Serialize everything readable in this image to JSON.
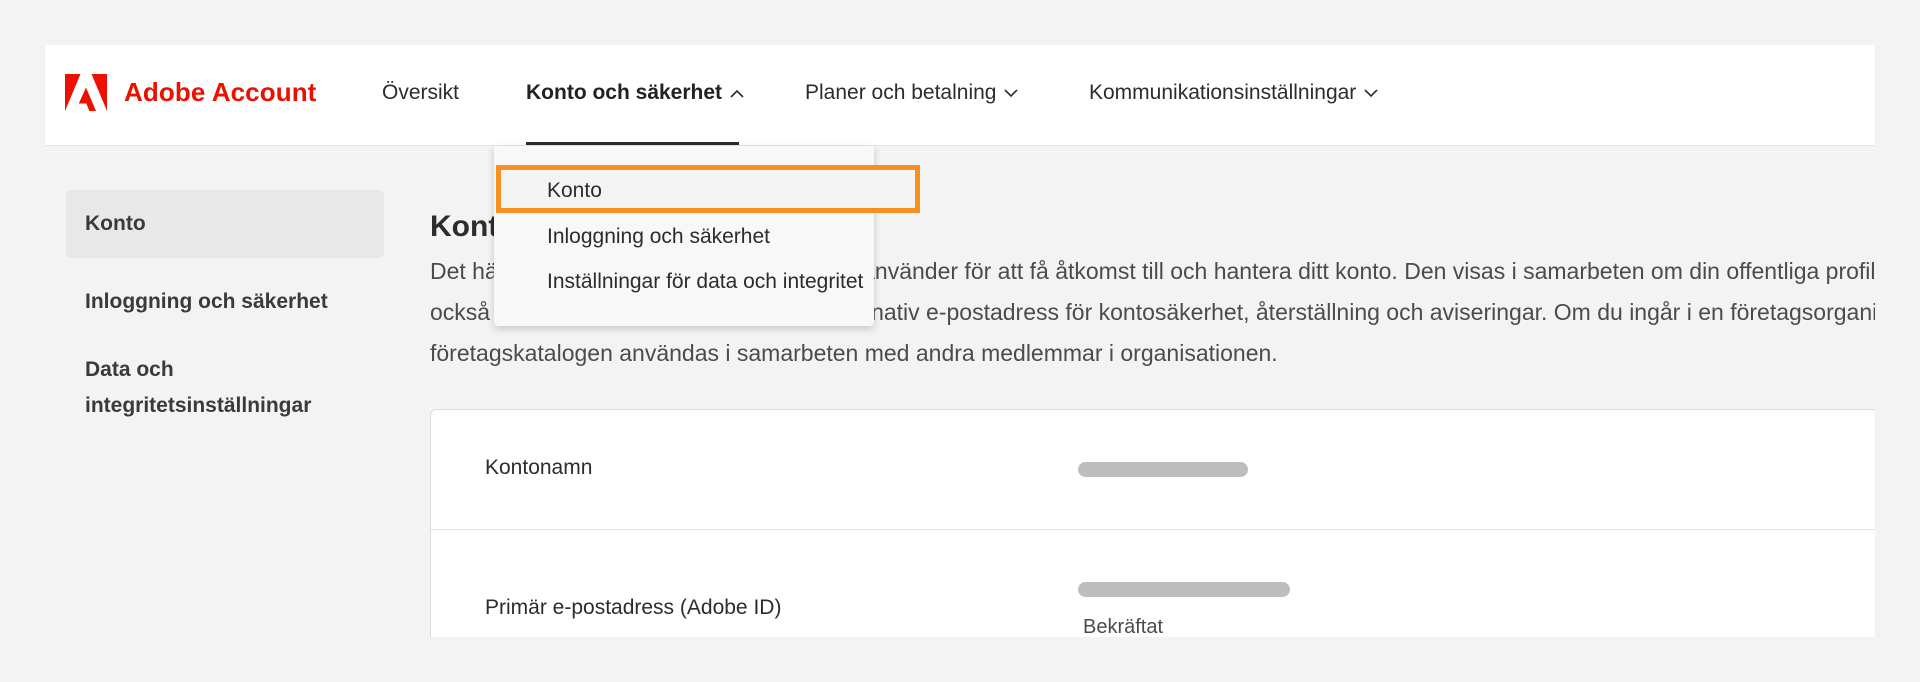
{
  "app": {
    "name": "Adobe Account"
  },
  "header": {
    "nav": [
      {
        "label": "Översikt",
        "has_chevron": false,
        "active": false
      },
      {
        "label": "Konto och säkerhet",
        "has_chevron": true,
        "chevron": "chevron-up-icon",
        "active": true
      },
      {
        "label": "Planer och betalning",
        "has_chevron": true,
        "chevron": "chevron-down-icon",
        "active": false
      },
      {
        "label": "Kommunikationsinställningar",
        "has_chevron": true,
        "chevron": "chevron-down-icon",
        "active": false
      }
    ]
  },
  "dropdown": {
    "items": [
      {
        "label": "Konto",
        "highlighted": true
      },
      {
        "label": "Inloggning och säkerhet"
      },
      {
        "label": "Inställningar för data och integritet"
      }
    ],
    "highlight_color": "#f7901e"
  },
  "sidebar": {
    "items": [
      {
        "label": "Konto",
        "selected": true
      },
      {
        "label": "Inloggning och säkerhet"
      },
      {
        "label_line1": "Data och",
        "label_line2": "integritetsinställningar"
      }
    ]
  },
  "main": {
    "heading": "Konto",
    "description_lines": [
      "Det här är namnet och e-postadressen du använder för att få åtkomst till och hantera ditt konto. Den visas i samarbeten om din offentliga profil är",
      "också synlig. Du kan även lägga till en alternativ e-postadress för kontosäkerhet, återställning och aviseringar. Om du ingår i en företagsorganisation kan",
      "företagskatalogen användas i samarbeten med andra medlemmar i organisationen."
    ],
    "account_card": {
      "rows": [
        {
          "label": "Kontonamn",
          "value_hidden": true
        },
        {
          "label": "Primär e-postadress (Adobe ID)",
          "value_hidden": true,
          "status": "Bekräftat"
        }
      ]
    }
  },
  "colors": {
    "brand": "#eb1000",
    "highlight": "#f7901e",
    "background": "#f3f3f3"
  }
}
